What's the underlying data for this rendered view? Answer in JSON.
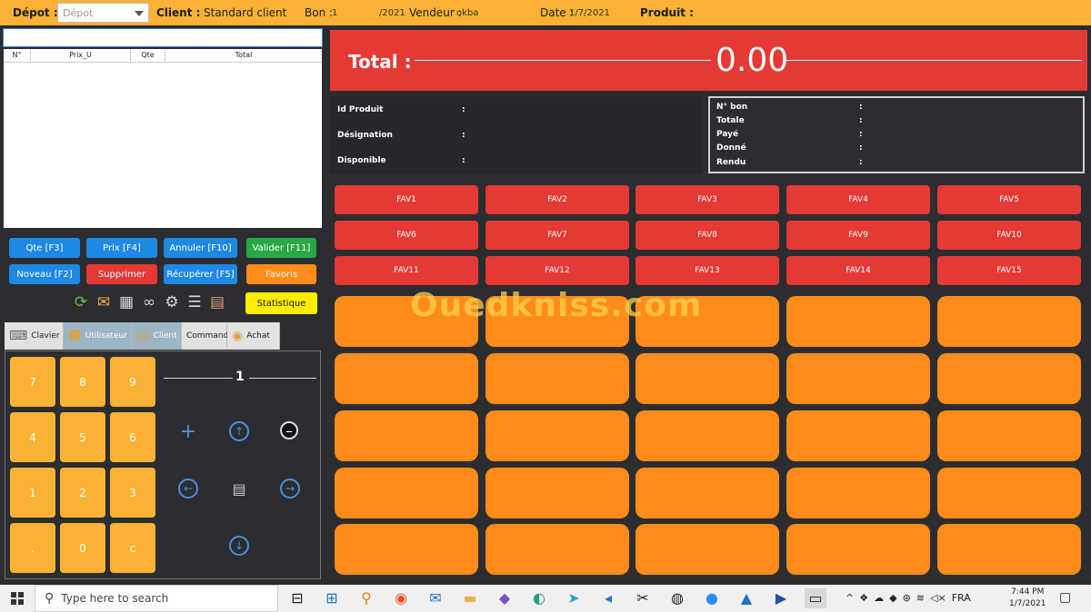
{
  "header": {
    "depot_label": "Dépot :",
    "depot_placeholder": "Dépot",
    "client_label": "Client :",
    "client_value": "Standard client",
    "bon_label": "Bon :",
    "bon_value": "1",
    "bon_year": "/2021",
    "vendeur_label": "Vendeur :",
    "vendeur_value": "okba",
    "date_label": "Date :",
    "date_value": "1/7/2021",
    "produit_label": "Produit :"
  },
  "table": {
    "columns": [
      "N°",
      "Prix_U",
      "Qte",
      "Total"
    ]
  },
  "actions": {
    "qte": "Qte [F3]",
    "prix": "Prix [F4]",
    "annuler": "Annuler [F10]",
    "valider": "Valider [F11]",
    "noveau": "Noveau [F2]",
    "supprimer": "Supprimer",
    "recuperer": "Récupérer [F5]",
    "favoris": "Favoris",
    "statistique": "Statistique"
  },
  "toolbar_icons": [
    "refresh-icon",
    "mail-icon",
    "users-icon",
    "binoculars-icon",
    "gear-icon",
    "list-icon",
    "clipboard-icon"
  ],
  "tabs": [
    {
      "label": "Clavier",
      "icon": "keyboard-icon"
    },
    {
      "label": "Utilisateur",
      "icon": "users-icon"
    },
    {
      "label": "Client",
      "icon": "person-icon"
    },
    {
      "label": "Commande",
      "icon": ""
    },
    {
      "label": "Achat",
      "icon": "coins-icon"
    }
  ],
  "keypad": {
    "keys": [
      "7",
      "8",
      "9",
      "4",
      "5",
      "6",
      "1",
      "2",
      "3",
      ".",
      "0",
      "c"
    ],
    "quantity": "1"
  },
  "total": {
    "label": "Total :",
    "value": "0.00"
  },
  "product_info": {
    "id_label": "Id Produit",
    "designation_label": "Désignation",
    "disponible_label": "Disponible",
    "colon": ":"
  },
  "bon_info": {
    "labels": [
      "N° bon",
      "Totale",
      "Payé",
      "Donné",
      "Rendu"
    ],
    "colon": ":"
  },
  "favorites": [
    "FAV1",
    "FAV2",
    "FAV3",
    "FAV4",
    "FAV5",
    "FAV6",
    "FAV7",
    "FAV8",
    "FAV9",
    "FAV10",
    "FAV11",
    "FAV12",
    "FAV13",
    "FAV14",
    "FAV15"
  ],
  "watermark": "Ouedkniss.com",
  "taskbar": {
    "search_placeholder": "Type here to search",
    "lang": "FRA",
    "time": "7:44 PM",
    "date": "1/7/2021"
  },
  "colors": {
    "header": "#f9b233",
    "total_bar": "#e53935",
    "product_button": "#ff8c1a",
    "key": "#f9b233"
  }
}
